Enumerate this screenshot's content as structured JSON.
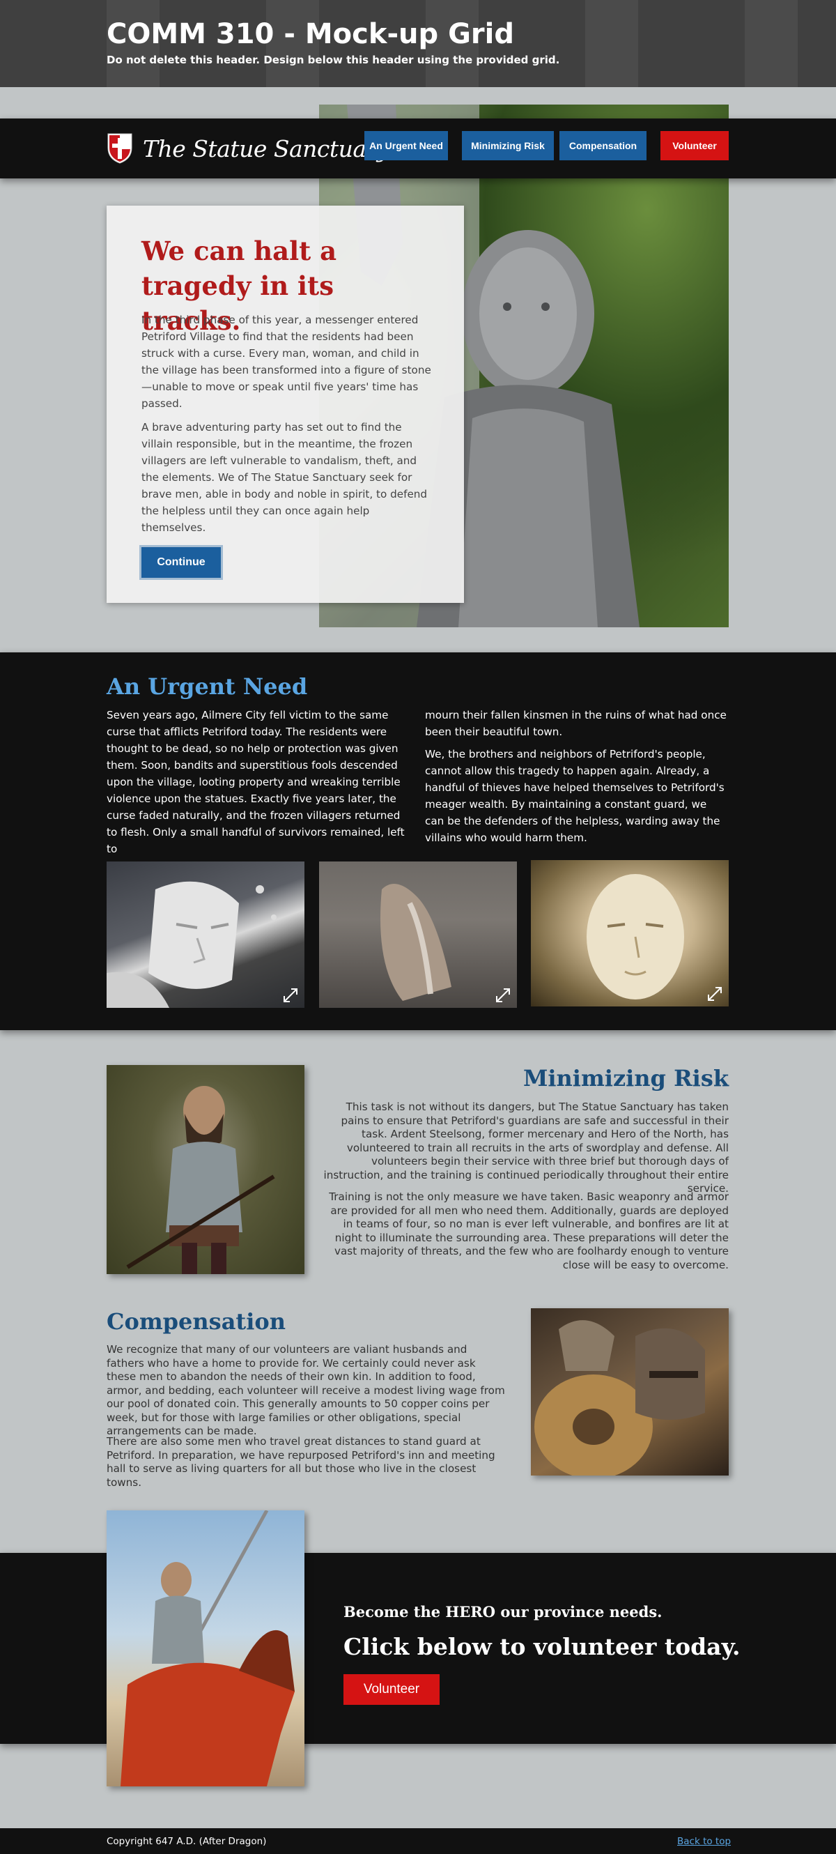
{
  "mockup_header": {
    "title": "COMM 310 - Mock-up Grid",
    "subtitle": "Do not delete this header. Design below this header using the provided grid."
  },
  "nav": {
    "logo_text": "The Statue Sanctuary",
    "items": [
      {
        "label": "An Urgent Need"
      },
      {
        "label": "Minimizing Risk"
      },
      {
        "label": "Compensation"
      },
      {
        "label": "Volunteer"
      }
    ]
  },
  "hero": {
    "title": "We can halt a tragedy in its tracks.",
    "p1": "In the third phase of this year, a messenger entered Petriford Village to find that the residents had been struck with a curse. Every man, woman, and child in the village has been transformed into a figure of stone—unable to move or speak until five years' time has passed.",
    "p2": "A brave adventuring party has set out to find the villain responsible, but in the meantime, the frozen villagers are left vulnerable to vandalism, theft, and the elements. We of The Statue Sanctuary seek for brave men, able in body and noble in spirit, to defend the helpless until they can once again help themselves.",
    "button": "Continue"
  },
  "urgent": {
    "title": "An Urgent Need",
    "p1": "Seven  years ago, Ailmere City fell victim to the same curse that afflicts Petriford today. The residents were thought to be dead, so no help or protection was given them. Soon, bandits and superstitious fools descended upon the village, looting property and wreaking terrible violence upon the statues. Exactly five years later, the curse faded naturally, and the frozen villagers returned to flesh. Only a small handful of survivors remained, left to",
    "p2": "mourn their fallen kinsmen in the ruins of what had once been their beautiful town.",
    "p3": "We, the brothers and neighbors of Petriford's people, cannot allow this tragedy to happen again. Already, a handful of thieves have helped themselves to Petriford's meager wealth. By maintaining a constant guard, we can be the defenders of the helpless, warding away the villains who would harm them."
  },
  "risk": {
    "title": "Minimizing Risk",
    "p1": "This task is not without its dangers, but The Statue Sanctuary has taken pains to ensure that Petriford's guardians are safe and successful in their task. Ardent Steelsong, former mercenary and Hero of the North, has volunteered to train all recruits in the arts of swordplay and defense.  All volunteers begin their service with three brief but thorough days of instruction, and the training is continued periodically throughout their entire service.",
    "p2": "Training is not the only measure we have taken. Basic weaponry and armor are provided for all men who need them. Additionally, guards are deployed in teams of four, so no man is ever left vulnerable, and bonfires are lit at night to illuminate the surrounding area. These preparations will deter the vast majority of threats, and the few who are foolhardy enough to venture close will be easy to overcome."
  },
  "compensation": {
    "title": "Compensation",
    "p1": "We recognize that many of our volunteers are valiant husbands and fathers who have a home to provide for. We certainly could never ask these men to abandon the needs of their own kin. In addition to food, armor, and bedding, each volunteer will receive a modest living wage from our pool of donated coin. This generally amounts to 50 copper coins per week, but for those with large families or other obligations, special arrangements can be made.",
    "p2": "There are also some men who travel great distances to stand guard at Petriford. In preparation, we have repurposed Petriford's inn and meeting hall to serve as living quarters for all but those who live in the closest towns."
  },
  "cta": {
    "subtitle": "Become the HERO our province needs.",
    "title": "Click below to volunteer today.",
    "button": "Volunteer"
  },
  "footer": {
    "copyright": "Copyright 647 A.D. (After Dragon)",
    "back_to_top": "Back to top"
  },
  "colors": {
    "accent_blue": "#1b5f9e",
    "accent_red": "#d51313",
    "heading_red": "#b01b1b",
    "heading_blue": "#1a4d7a",
    "light_blue": "#5aa5e2",
    "dark": "#111111",
    "page_bg": "#c1c5c6"
  }
}
